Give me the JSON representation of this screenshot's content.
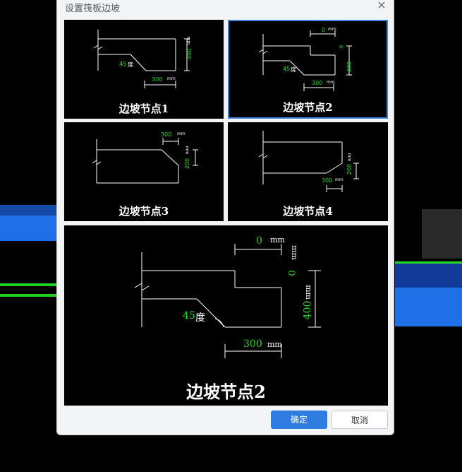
{
  "dialog": {
    "title": "设置筏板边坡",
    "close_icon": "close-icon",
    "ok_label": "确定",
    "cancel_label": "取消"
  },
  "nodes": [
    {
      "label": "边坡节点1",
      "width": "300",
      "height": "400",
      "angle": "45",
      "unit": "mm",
      "angle_unit": "度"
    },
    {
      "label": "边坡节点2",
      "offset": "0",
      "width": "300",
      "height": "400",
      "angle": "45",
      "unit": "mm",
      "angle_unit": "度",
      "side_offset": "0"
    },
    {
      "label": "边坡节点3",
      "width": "300",
      "height": "200",
      "unit": "mm"
    },
    {
      "label": "边坡节点4",
      "width": "300",
      "height": "200",
      "unit": "mm"
    }
  ],
  "preview": {
    "label": "边坡节点2",
    "offset": "0",
    "width": "300",
    "height": "400",
    "angle": "45",
    "side_offset": "0",
    "unit": "mm",
    "angle_unit": "度"
  },
  "colors": {
    "accent": "#2f7ce2",
    "dimension_text": "#22dd22",
    "line": "#ffffff"
  }
}
